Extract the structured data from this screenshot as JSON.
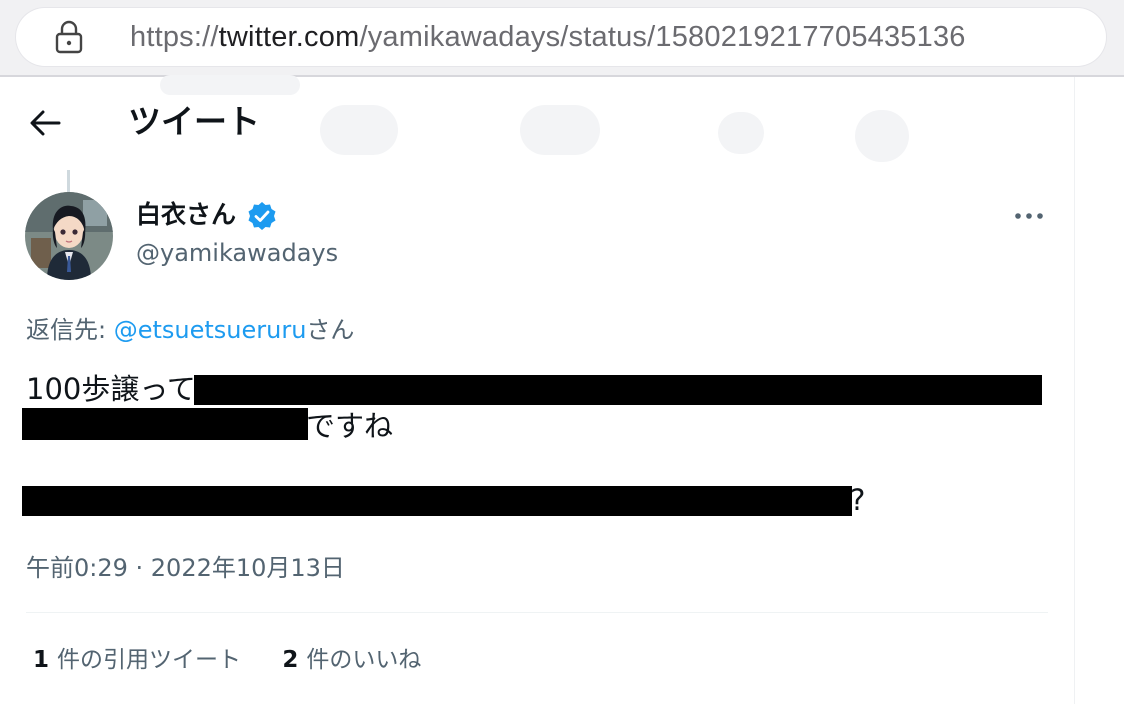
{
  "browser": {
    "url_prefix": "https://",
    "url_domain": "twitter.com",
    "url_path": "/yamikawadays/status/1580219217705435136"
  },
  "header": {
    "title": "ツイート"
  },
  "author": {
    "name": "白衣さん",
    "handle": "@yamikawadays",
    "verified": true
  },
  "tweet": {
    "reply_label": "返信先: ",
    "reply_mention": "@etsuetsueruru",
    "reply_suffix": "さん",
    "line1_visible": "100歩譲って",
    "line2_visible": "ですね",
    "line3_visible": "?",
    "timestamp": "午前0:29 · 2022年10月13日"
  },
  "stats": {
    "quotes_count": "1",
    "quotes_label": "件の引用ツイート",
    "likes_count": "2",
    "likes_label": "件のいいね"
  },
  "colors": {
    "accent": "#1d9bf0",
    "secondary_text": "#536471",
    "redaction": "#000000"
  }
}
